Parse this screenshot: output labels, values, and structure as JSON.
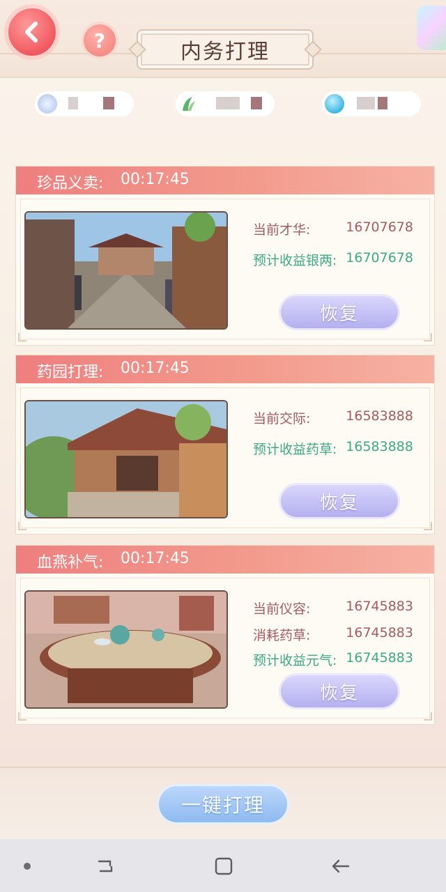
{
  "header": {
    "title": "内务打理",
    "back_icon": "chevron-left-icon",
    "help_label": "?"
  },
  "resources": [
    {
      "icon": "silver-coin-icon",
      "color": "#a9c2e8"
    },
    {
      "icon": "herb-icon",
      "color": "#5bb56b"
    },
    {
      "icon": "blue-orb-icon",
      "color": "#3fb7e0"
    }
  ],
  "cards": [
    {
      "name": "珍品义卖:",
      "timer": "00:17:45",
      "stats": [
        {
          "label": "当前才华:",
          "value": "16707678",
          "type": "normal"
        },
        {
          "label": "预计收益银两:",
          "value": "16707678",
          "type": "gain"
        }
      ],
      "button": "恢复"
    },
    {
      "name": "药园打理:",
      "timer": "00:17:45",
      "stats": [
        {
          "label": "当前交际:",
          "value": "16583888",
          "type": "normal"
        },
        {
          "label": "预计收益药草:",
          "value": "16583888",
          "type": "gain"
        }
      ],
      "button": "恢复"
    },
    {
      "name": "血燕补气:",
      "timer": "00:17:45",
      "stats": [
        {
          "label": "当前仪容:",
          "value": "16745883",
          "type": "normal"
        },
        {
          "label": "消耗药草:",
          "value": "16745883",
          "type": "normal"
        },
        {
          "label": "预计收益元气:",
          "value": "16745883",
          "type": "gain"
        }
      ],
      "button": "恢复"
    }
  ],
  "footer": {
    "main_button": "一键打理"
  },
  "colors": {
    "accent": "#ee7f7f",
    "gain": "#3bab86",
    "stat": "#a65b5f"
  }
}
